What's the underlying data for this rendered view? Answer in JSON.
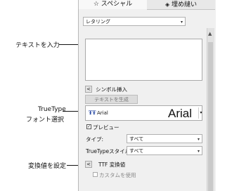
{
  "callouts": {
    "enter_text": "テキストを入力",
    "truetype_line1": "TrueType",
    "truetype_line2": "フォント選択",
    "set_conversion": "変換値を設定"
  },
  "tabs": [
    {
      "label": "スペシャル",
      "icon": "star-icon",
      "active": true
    },
    {
      "label": "埋め縫い",
      "icon": "fill-stitch-icon",
      "active": false
    }
  ],
  "lettering_select": {
    "value": "レタリング"
  },
  "symbol_insert": {
    "label": "シンボル挿入",
    "toggle": "<"
  },
  "generate_text_button": "テキストを生成",
  "font": {
    "name": "Arial",
    "preview_text": "Arial",
    "icon": "truetype-icon"
  },
  "preview_checkbox": {
    "label": "プレビュー",
    "checked": true
  },
  "type_field": {
    "label": "タイプ:",
    "value": "すべて"
  },
  "truetype_style_field": {
    "label": "TrueTypeスタイル:",
    "value": "すべて"
  },
  "ttf_conversion": {
    "label": "TTF 変換値",
    "toggle": "<"
  },
  "use_custom": {
    "label": "カスタムを使用",
    "checked": false
  }
}
